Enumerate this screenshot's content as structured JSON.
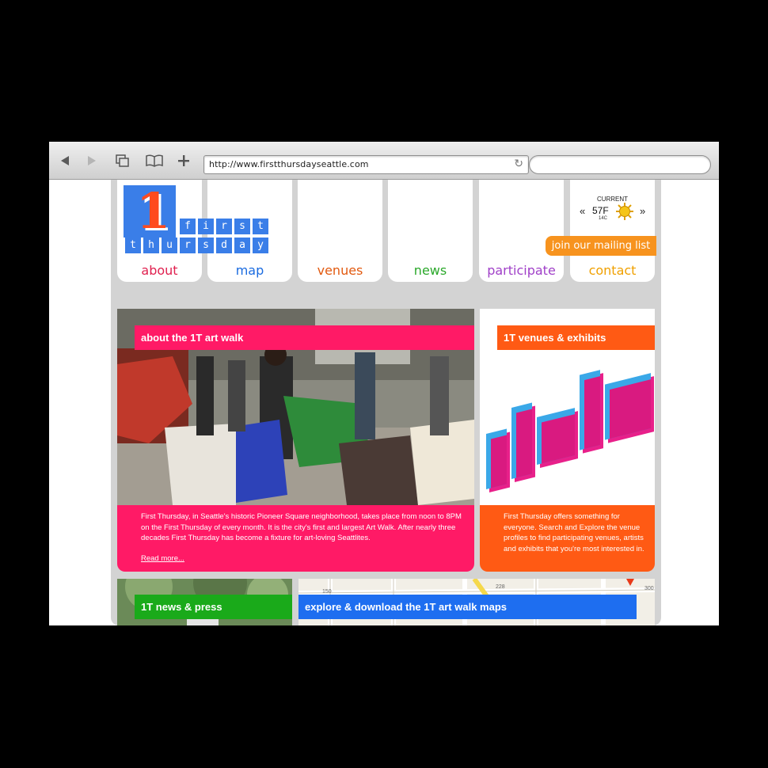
{
  "browser": {
    "url": "http://www.firstthursdayseattle.com",
    "search_value": ""
  },
  "logo": {
    "numeral": "1",
    "line1": [
      "f",
      "i",
      "r",
      "s",
      "t"
    ],
    "line2": [
      "t",
      "h",
      "u",
      "r",
      "s",
      "d",
      "a",
      "y"
    ]
  },
  "nav": {
    "about": "about",
    "map": "map",
    "venues": "venues",
    "news": "news",
    "participate": "participate",
    "contact": "contact"
  },
  "weather": {
    "label": "CURRENT",
    "temp_f": "57F",
    "temp_c": "14C",
    "prev": "«",
    "next": "»"
  },
  "mailing_list": "join our mailing list",
  "about_card": {
    "title": "about the 1T art walk",
    "body": "First Thursday, in Seattle's historic Pioneer Square neighborhood, takes place from noon to 8PM on the First Thursday of every month. It is the city's first and largest Art Walk. After nearly three decades First Thursday has become a fixture for art-loving Seattlites.",
    "read_more": "Read more..."
  },
  "venues_card": {
    "title": "1T venues & exhibits",
    "body_pre": "First Thursday offers something for everyone. ",
    "body_link": "Search and Explore",
    "body_post": " the venue profiles to find participating venues, artists and exhibits that you're most interested in."
  },
  "news_card": {
    "title": "1T news & press"
  },
  "maps_card": {
    "title": "explore & download the 1T art walk maps",
    "map_numbers": [
      "150",
      "228",
      "300"
    ]
  },
  "colors": {
    "pink": "#ff1a66",
    "orange": "#ff5a14",
    "green": "#1aaa1a",
    "blue": "#1e6ef0",
    "amber": "#f7931e",
    "purple": "#a040c8",
    "nav_about": "#e0204f",
    "nav_map": "#1a6be0",
    "nav_venues": "#e25a10",
    "nav_news": "#2aa82a",
    "nav_participate": "#a040c8",
    "nav_contact": "#f0a000"
  }
}
